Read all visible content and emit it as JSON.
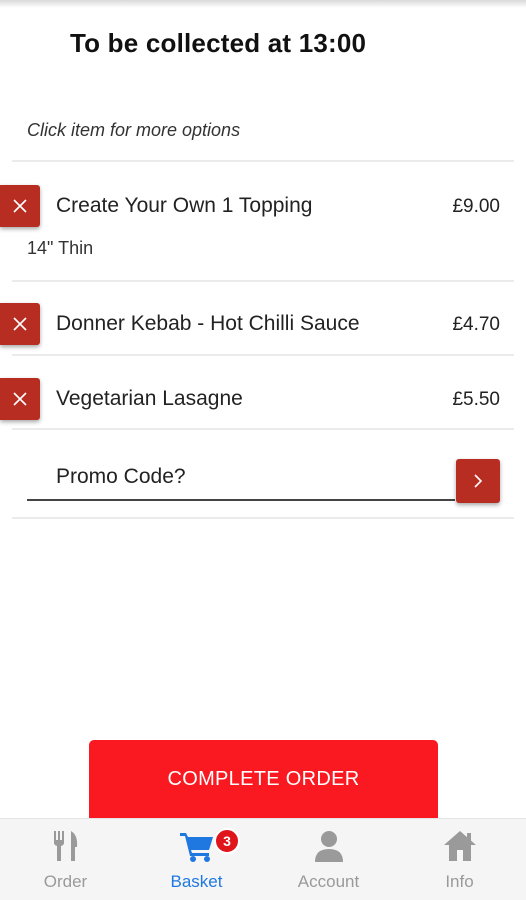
{
  "header": {
    "collection_time": "To be collected at 13:00"
  },
  "basket": {
    "hint": "Click item for more options",
    "items": [
      {
        "name": "Create Your Own 1 Topping",
        "price": "£9.00",
        "option": "14\" Thin"
      },
      {
        "name": "Donner Kebab - Hot Chilli Sauce",
        "price": "£4.70"
      },
      {
        "name": "Vegetarian Lasagne",
        "price": "£5.50"
      }
    ],
    "promo": {
      "placeholder": "Promo Code?",
      "value": ""
    }
  },
  "actions": {
    "complete_label": "COMPLETE ORDER"
  },
  "tabbar": {
    "tabs": [
      {
        "label": "Order",
        "icon": "fork-knife-icon"
      },
      {
        "label": "Basket",
        "icon": "cart-icon",
        "active": true
      },
      {
        "label": "Account",
        "icon": "person-icon"
      },
      {
        "label": "Info",
        "icon": "home-icon"
      }
    ],
    "basket_count": "3"
  },
  "colors": {
    "accent_red": "#b72d22",
    "cta_red": "#fa1920",
    "active_blue": "#1f78e0",
    "inactive_grey": "#9a9a9a"
  }
}
